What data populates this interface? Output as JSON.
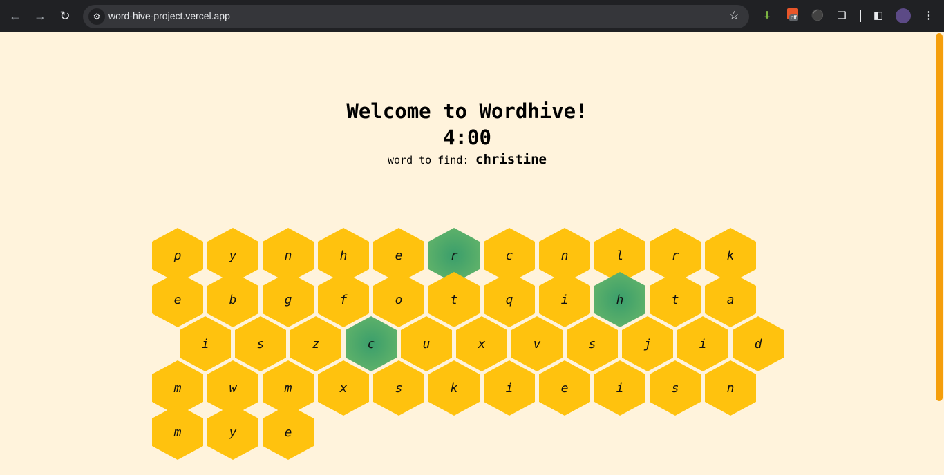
{
  "browser": {
    "url": "word-hive-project.vercel.app",
    "icons": [
      "back-arrow-icon",
      "forward-arrow-icon",
      "reload-icon",
      "site-settings-icon",
      "bookmark-star-icon",
      "download-extension-icon",
      "off-extension-icon",
      "ball-extension-icon",
      "puzzle-extensions-icon",
      "side-panel-icon",
      "profile-avatar",
      "kebab-menu-icon"
    ],
    "off_badge": "off"
  },
  "game": {
    "title": "Welcome to Wordhive!",
    "timer": "4:00",
    "find_label": "word to find:",
    "target_word": "christine",
    "colors": {
      "tile": "#ffc20e",
      "found": "#4caf6e",
      "background": "#fff3dc",
      "scrollbar": "#f59e0b"
    },
    "rows": [
      {
        "offset": false,
        "letters": [
          "p",
          "y",
          "n",
          "h",
          "e",
          "r",
          "c",
          "n",
          "l",
          "r",
          "k"
        ],
        "found": [
          5
        ]
      },
      {
        "offset": false,
        "letters": [
          "e",
          "b",
          "g",
          "f",
          "o",
          "t",
          "q",
          "i",
          "h",
          "t",
          "a"
        ],
        "found": [
          8
        ]
      },
      {
        "offset": true,
        "letters": [
          "i",
          "s",
          "z",
          "c",
          "u",
          "x",
          "v",
          "s",
          "j",
          "i",
          "d"
        ],
        "found": [
          3
        ]
      },
      {
        "offset": false,
        "letters": [
          "m",
          "w",
          "m",
          "x",
          "s",
          "k",
          "i",
          "e",
          "i",
          "s",
          "n"
        ],
        "found": []
      },
      {
        "offset": false,
        "letters": [
          "m",
          "y",
          "e"
        ],
        "found": []
      }
    ]
  }
}
